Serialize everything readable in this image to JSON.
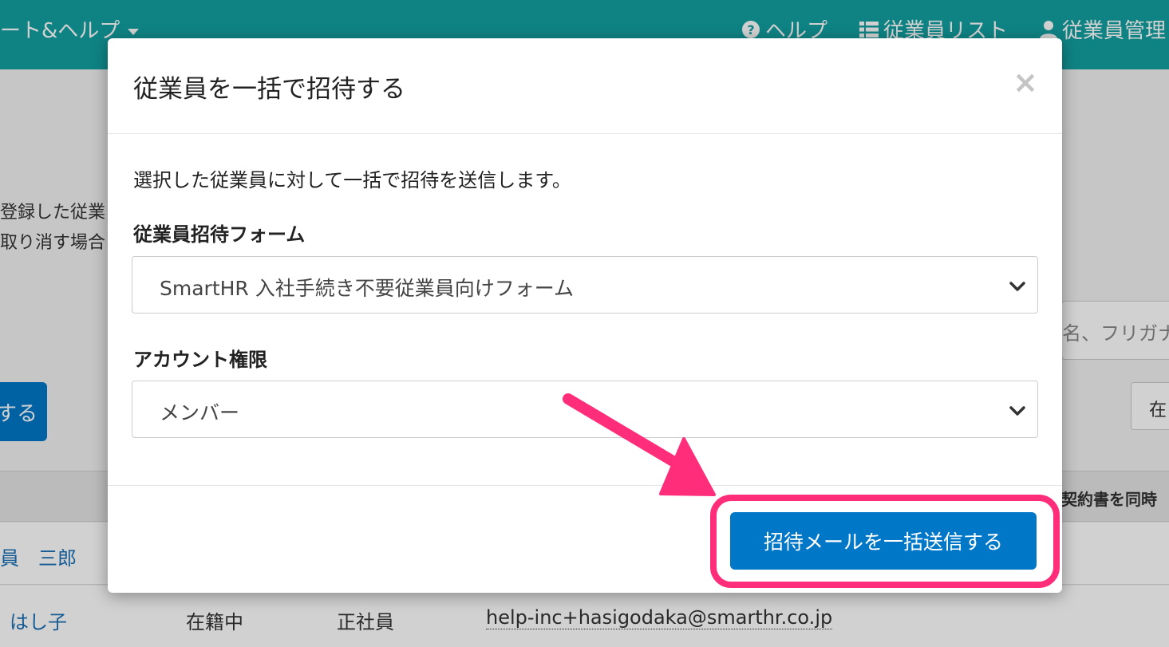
{
  "topbar": {
    "menu_label": "ート&ヘルプ",
    "nav": [
      {
        "label": "ヘルプ",
        "icon": "help-circle-icon"
      },
      {
        "label": "従業員リスト",
        "icon": "list-icon"
      },
      {
        "label": "従業員管理",
        "icon": "user-icon"
      }
    ],
    "color": "#13a0a2"
  },
  "background": {
    "text_line_1": "登録した従業",
    "text_line_2": "取り消す場合",
    "button_label": "する",
    "search_placeholder": "名、フリガナ",
    "status_select": "在",
    "table_header_text": "契約書を同時",
    "rows": [
      {
        "name": "員　三郎"
      },
      {
        "name": "はし子",
        "status": "在籍中",
        "type": "正社員",
        "email": "help-inc+hasigodaka@smarthr.co.jp"
      }
    ]
  },
  "modal": {
    "title": "従業員を一括で招待する",
    "close": "×",
    "description": "選択した従業員に対して一括で招待を送信します。",
    "form_label": "従業員招待フォーム",
    "form_value": "SmartHR 入社手続き不要従業員向けフォーム",
    "role_label": "アカウント権限",
    "role_value": "メンバー",
    "submit_label": "招待メールを一括送信する"
  },
  "colors": {
    "primary": "#0077c7",
    "highlight": "#ff2d7a"
  }
}
